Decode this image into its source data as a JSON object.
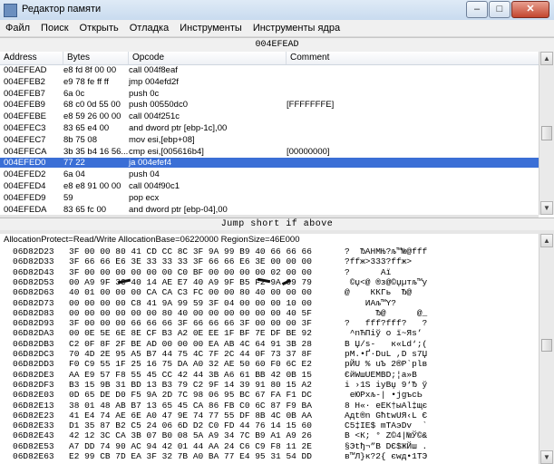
{
  "window": {
    "title": "Редактор памяти",
    "minimize": "–",
    "maximize": "□",
    "close": "✕"
  },
  "menu": [
    "Файл",
    "Поиск",
    "Открыть",
    "Отладка",
    "Инструменты",
    "Инструменты ядра"
  ],
  "address_bar": "004EFEAD",
  "disasm": {
    "columns": [
      "Address",
      "Bytes",
      "Opcode",
      "Comment"
    ],
    "rows": [
      {
        "addr": "004EFEAD",
        "bytes": "e8 fd 8f 00 00",
        "op": "call 004f8eaf",
        "comment": ""
      },
      {
        "addr": "004EFEB2",
        "bytes": "e9 78 fe ff ff",
        "op": "jmp 004efd2f",
        "comment": ""
      },
      {
        "addr": "004EFEB7",
        "bytes": "6a 0c",
        "op": "push 0c",
        "comment": ""
      },
      {
        "addr": "004EFEB9",
        "bytes": "68 c0 0d 55 00",
        "op": "push 00550dc0",
        "comment": "[FFFFFFFE]"
      },
      {
        "addr": "004EFEBE",
        "bytes": "e8 59 26 00 00",
        "op": "call 004f251c",
        "comment": ""
      },
      {
        "addr": "004EFEC3",
        "bytes": "83 65 e4 00",
        "op": "and dword ptr [ebp-1c],00",
        "comment": ""
      },
      {
        "addr": "004EFEC7",
        "bytes": "8b 75 08",
        "op": "mov esi,[ebp+08]",
        "comment": ""
      },
      {
        "addr": "004EFECA",
        "bytes": "3b 35 b4 16 56...",
        "op": "cmp esi,[005616b4]",
        "comment": "[00000000]"
      },
      {
        "addr": "004EFED0",
        "bytes": "77 22",
        "op": "ja 004efef4",
        "comment": ""
      },
      {
        "addr": "004EFED2",
        "bytes": "6a 04",
        "op": "push 04",
        "comment": ""
      },
      {
        "addr": "004EFED4",
        "bytes": "e8 e8 91 00 00",
        "op": "call 004f90c1",
        "comment": ""
      },
      {
        "addr": "004EFED9",
        "bytes": "59",
        "op": "pop ecx",
        "comment": ""
      },
      {
        "addr": "004EFEDA",
        "bytes": "83 65 fc 00",
        "op": "and dword ptr [ebp-04],00",
        "comment": ""
      }
    ],
    "selected_index": 8
  },
  "instruction_description": "Jump short if above",
  "memory_info": "AllocationProtect=Read/Write  AllocationBase=06220000  RegionSize=46E000",
  "hex_rows": [
    {
      "addr": "06D82D23",
      "hex": "3F 00 00 80 41 CD CC 8C 3F 9A 99 B9 40 66 66 66",
      "ascii": "?  ЂAНМЊ?љ™№@fff"
    },
    {
      "addr": "06D82D33",
      "hex": "3F 66 66 E6 3E 33 33 33 3F 66 66 E6 3E 00 00 00",
      "ascii": "?ffж>333?ffж>"
    },
    {
      "addr": "06D82D43",
      "hex": "3F 00 00 00 00 00 00 C0 BF 00 00 00 00 02 00 00",
      "ascii": "?      Аї"
    },
    {
      "addr": "06D82D53",
      "hex": "00 A9 9F 3C 40 14 AE E7 40 A9 9F B5 F2 9A 99 79",
      "ascii": " ©џ<@ ®з@©џµтљ™y"
    },
    {
      "addr": "06D82D63",
      "hex": "40 01 00 00 00 CA CA C3 FC 00 00 80 40 00 00 00",
      "ascii": "@    ККГь  Ђ@"
    },
    {
      "addr": "06D82D73",
      "hex": "00 00 00 00 C8 41 9A 99 59 3F 04 00 00 00 10 00",
      "ascii": "    ИAљ™Y?"
    },
    {
      "addr": "06D82D83",
      "hex": "00 00 00 00 00 00 80 40 00 00 00 00 00 00 40 5F",
      "ascii": "      Ђ@      @_"
    },
    {
      "addr": "06D82D93",
      "hex": "3F 00 00 00 66 66 66 3F 66 66 66 3F 00 00 00 3F",
      "ascii": "?   fff?fff?   ?"
    },
    {
      "addr": "06D82DA3",
      "hex": "00 0E 5E 6E 8E CF B3 A2 0E EE 1F BF 7E DF BE 92",
      "ascii": " ^nЋПіў о ї~Яѕ’"
    },
    {
      "addr": "06D82DB3",
      "hex": "C2 0F 8F 2F BE AD 00 00 00 EA AB 4C 64 91 3B 28",
      "ascii": "В Џ/ѕ-   к«Ld‘;("
    },
    {
      "addr": "06D82DC3",
      "hex": "70 4D 2E 95 A5 B7 44 75 4C 7F 2C 44 0F 73 37 8F",
      "ascii": "pM.•Ґ·DuL ,D s7Џ"
    },
    {
      "addr": "06D82DD3",
      "hex": "F0 C9 55 1F 25 16 75 DA A0 32 AE 50 60 F0 6C E2",
      "ascii": "рЙU % uЪ 2®P`рlв"
    },
    {
      "addr": "06D82DE3",
      "hex": "AA E9 57 F8 55 45 CC 42 44 3B A6 61 BB 42 0B 15",
      "ascii": "ЄйWшUEМBD;¦a»B"
    },
    {
      "addr": "06D82DF3",
      "hex": "B3 15 9B 31 BD 13 B3 79 C2 9F 14 39 91 80 15 A2",
      "ascii": "і ›1Ѕ іyВџ 9‘Ђ ў"
    },
    {
      "addr": "06D82E03",
      "hex": "0D 65 DE D0 F5 9A 2D 7C 98 06 95 BC 67 FA F1 DC",
      "ascii": " eЮРхљ-| •јgъсЬ"
    },
    {
      "addr": "06D82E13",
      "hex": "38 01 48 AB B7 13 65 45 CA 86 FB C0 6C 87 F9 BA",
      "ascii": "8 H«· eEК†ыАl‡щє"
    },
    {
      "addr": "06D82E23",
      "hex": "41 E4 74 AE 6E A0 47 9E 74 77 55 DF 8B 4C 0B AA",
      "ascii": "Aдt®n GћtwUЯ‹L Є"
    },
    {
      "addr": "06D82E33",
      "hex": "D1 35 87 B2 C5 24 06 6D D2 C0 FD 44 76 14 15 60",
      "ascii": "С5‡ІЕ$ mТАэDv  `"
    },
    {
      "addr": "06D82E43",
      "hex": "42 12 3C CA 3B 07 B0 08 5A A9 34 7C B9 A1 A9 26",
      "ascii": "B <К; ° Z©4|№Ў©&"
    },
    {
      "addr": "06D82E53",
      "hex": "A7 DD 74 90 AC 94 42 01 44 AA 24 C6 C9 F8 11 2E",
      "ascii": "§Эtђ¬”B DЄ$ЖЙш ."
    },
    {
      "addr": "06D82E63",
      "hex": "E2 99 CB 7D EA 3F 32 7B A0 BA 77 E4 95 31 54 DD",
      "ascii": "в™Л}к?2{ єwд•1TЭ"
    }
  ]
}
